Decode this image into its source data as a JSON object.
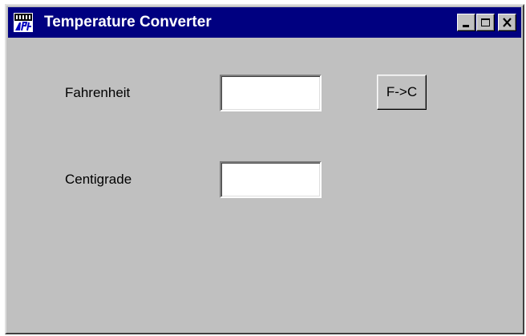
{
  "window": {
    "title": "Temperature Converter",
    "app_icon": "application-icon",
    "controls": {
      "minimize": "minimize-icon",
      "maximize": "maximize-icon",
      "close": "close-icon"
    }
  },
  "form": {
    "fahrenheit_label": "Fahrenheit",
    "fahrenheit_value": "",
    "centigrade_label": "Centigrade",
    "centigrade_value": "",
    "convert_button_label": "F->C"
  },
  "colors": {
    "titlebar": "#000080",
    "face": "#c0c0c0"
  }
}
